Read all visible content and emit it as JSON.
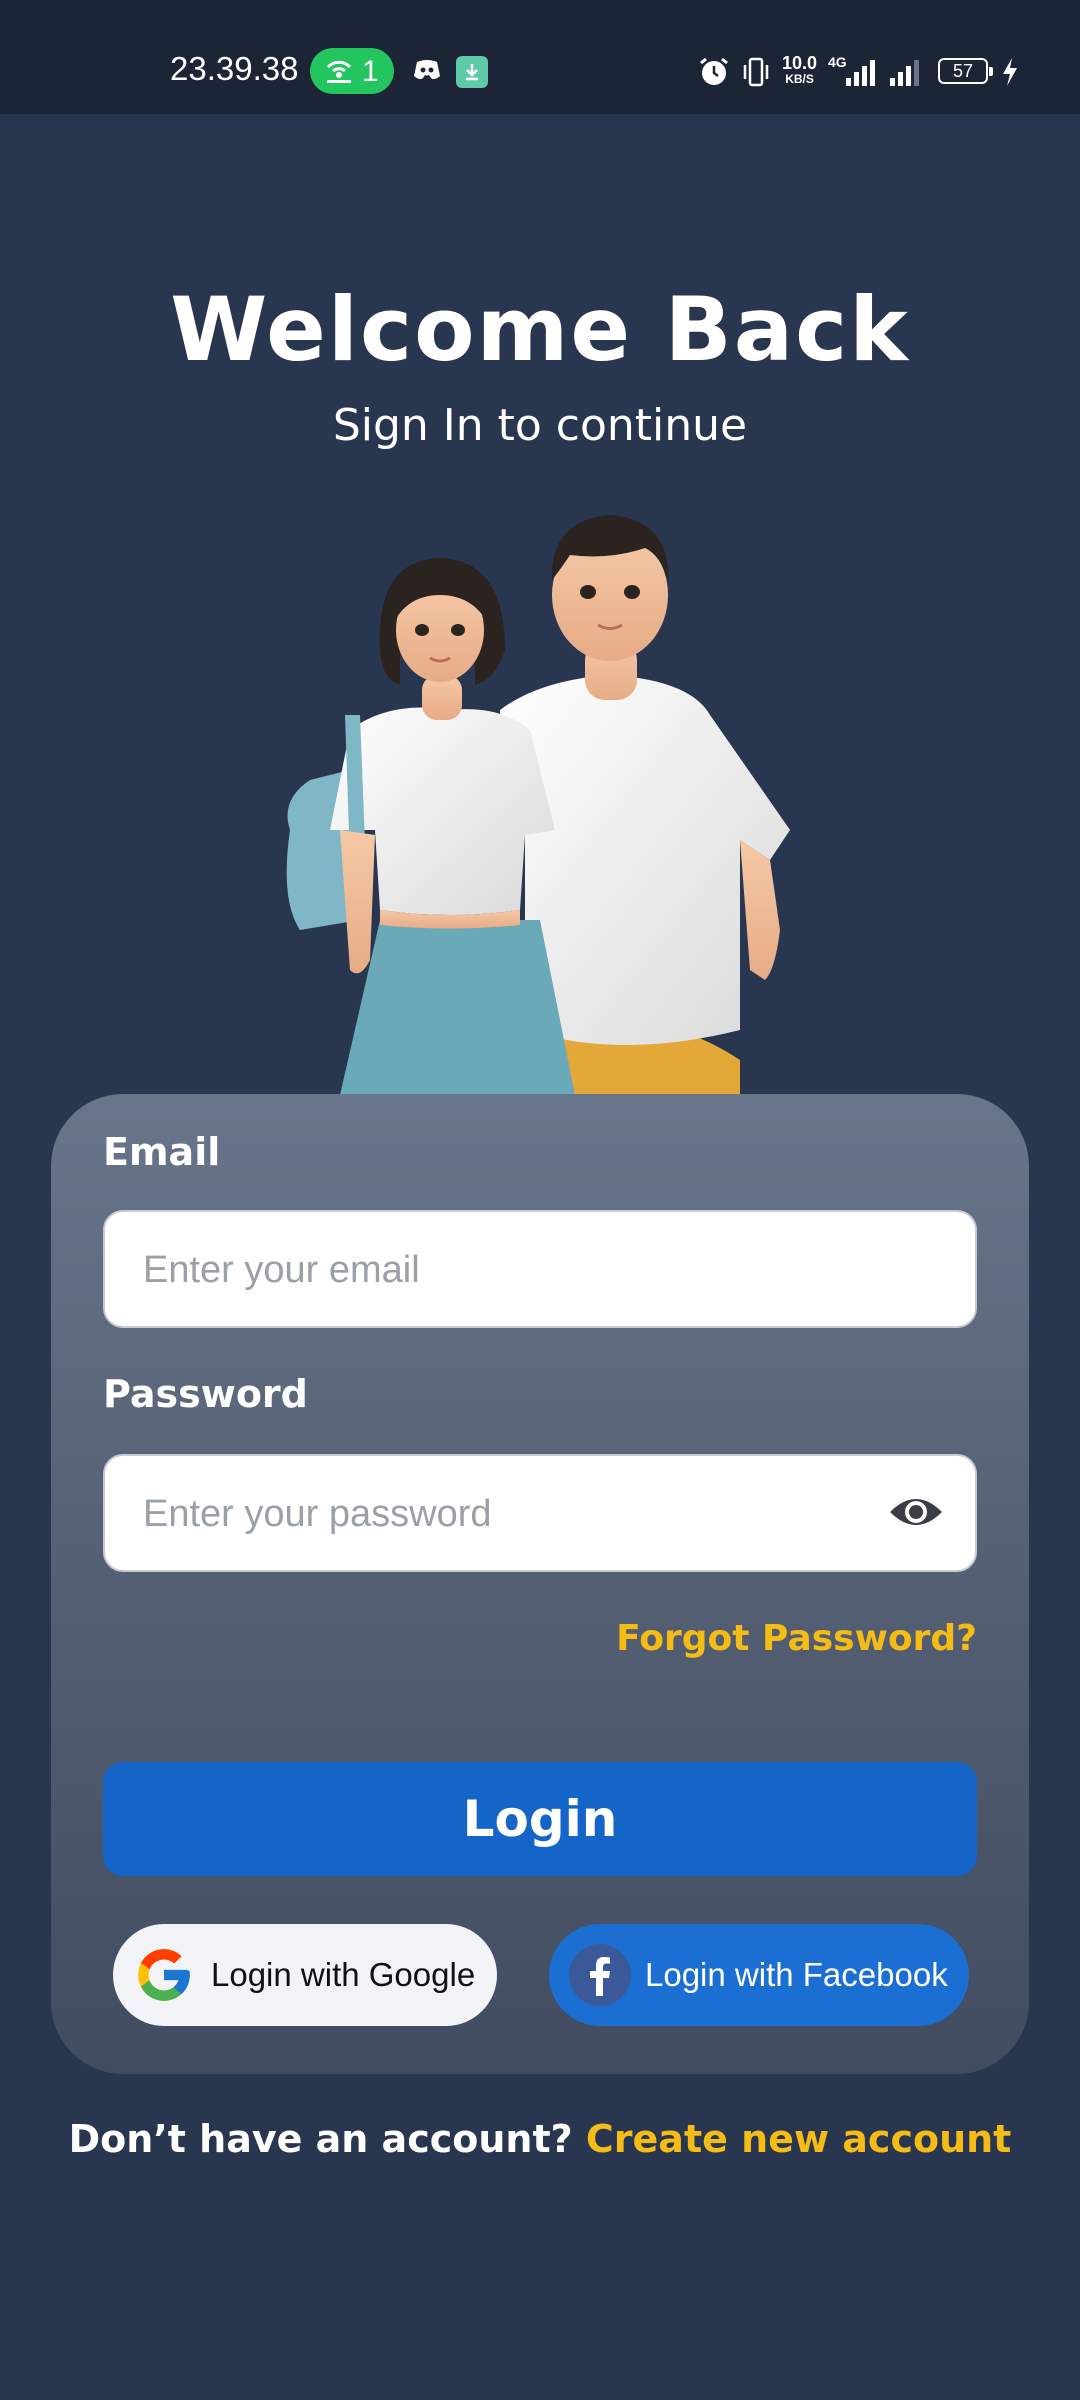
{
  "status_bar": {
    "time": "23.39.38",
    "hotspot_count": "1",
    "net_speed_value": "10.0",
    "net_speed_unit": "KB/S",
    "network_type": "4G",
    "battery": "57",
    "icons": [
      "hotspot-icon",
      "discord-icon",
      "download-icon",
      "alarm-icon",
      "vibrate-icon",
      "signal-icon",
      "signal-icon-2",
      "battery-icon",
      "charging-icon"
    ]
  },
  "header": {
    "title": "Welcome Back",
    "subtitle": "Sign In to continue"
  },
  "form": {
    "email_label": "Email",
    "email_placeholder": "Enter your email",
    "email_value": "",
    "password_label": "Password",
    "password_placeholder": "Enter your password",
    "password_value": "",
    "forgot_label": "Forgot Password?",
    "login_label": "Login",
    "google_label": "Login with Google",
    "facebook_label": "Login with Facebook"
  },
  "footer": {
    "question": "Don’t have an account?",
    "link": "Create new account"
  },
  "colors": {
    "background": "#293650",
    "accent": "#f6bc16",
    "primary": "#1565c9",
    "facebook": "#1b6fd3"
  }
}
